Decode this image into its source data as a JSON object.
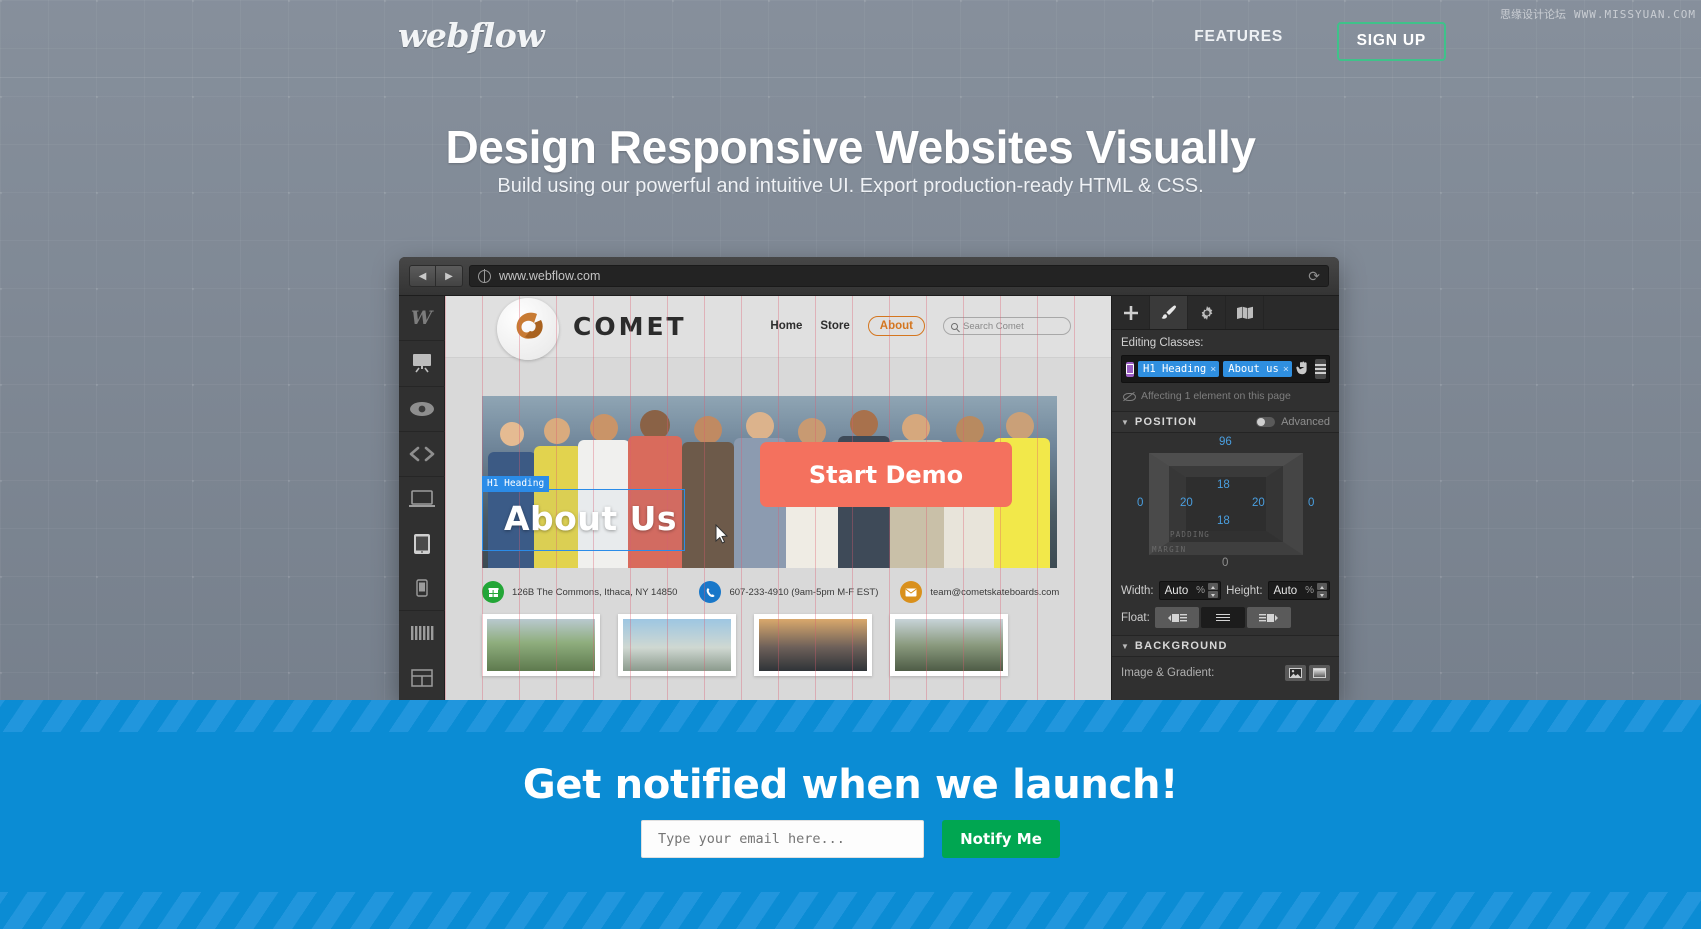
{
  "site": {
    "logo_text": "webflow",
    "nav": {
      "features": "FEATURES",
      "signup": "SIGN UP"
    },
    "watermark_cn": "思缘设计论坛",
    "watermark_url": "WWW.MISSYUAN.COM"
  },
  "hero": {
    "title": "Design Responsive Websites Visually",
    "subtitle": "Build using our powerful and intuitive UI. Export production-ready HTML & CSS."
  },
  "browser": {
    "back_icon": "◀",
    "forward_icon": "▶",
    "url": "www.webflow.com",
    "reload_icon": "⟳"
  },
  "designer": {
    "left_toolbar": [
      {
        "name": "webflow-logo",
        "glyph": "W"
      },
      {
        "name": "add-panel",
        "glyph": "▭"
      },
      {
        "name": "preview-eye",
        "glyph": "◉"
      },
      {
        "name": "code-view",
        "glyph": "<>"
      },
      {
        "name": "desktop-view",
        "glyph": "▭"
      },
      {
        "name": "tablet-view",
        "glyph": "▯"
      },
      {
        "name": "mobile-view",
        "glyph": "▯"
      },
      {
        "name": "columns-view",
        "glyph": "||||"
      },
      {
        "name": "layout-view",
        "glyph": "▤"
      }
    ],
    "canvas_site": {
      "brand": "COMET",
      "links": [
        {
          "label": "Home",
          "active": false
        },
        {
          "label": "Store",
          "active": false
        },
        {
          "label": "About",
          "active": true
        }
      ],
      "search_placeholder": "Search Comet",
      "selection_tag": "H1  Heading",
      "heading": "About Us",
      "cta_button": "Start Demo",
      "contacts": [
        {
          "icon": "store-icon",
          "color": "#23a637",
          "text": "126B The Commons, Ithaca, NY 14850"
        },
        {
          "icon": "phone-icon",
          "color": "#1877c9",
          "text": "607-233-4910 (9am-5pm M-F EST)"
        },
        {
          "icon": "mail-icon",
          "color": "#d9901c",
          "text": "team@cometskateboards.com"
        }
      ]
    },
    "right_panel": {
      "tabs": [
        {
          "name": "add-elements-tab",
          "glyph": "✛",
          "active": false
        },
        {
          "name": "style-brush-tab",
          "glyph": "🖌",
          "active": true
        },
        {
          "name": "settings-gear-tab",
          "glyph": "⚙",
          "active": false
        },
        {
          "name": "site-map-tab",
          "glyph": "📖",
          "active": false
        }
      ],
      "editing_classes_label": "Editing Classes:",
      "classes": [
        {
          "name": "H1 Heading"
        },
        {
          "name": "About us"
        }
      ],
      "class_remove_glyph": "×",
      "affecting_text": "Affecting 1 element on this page",
      "position_section": {
        "title": "POSITION",
        "advanced_label": "Advanced",
        "margin_top": "96",
        "margin_right": "0",
        "margin_bottom": "0",
        "margin_left": "0",
        "padding_top": "18",
        "padding_right": "20",
        "padding_bottom": "18",
        "padding_left": "20",
        "padding_label": "PADDING",
        "margin_label": "MARGIN"
      },
      "width_label": "Width:",
      "width_value": "Auto",
      "width_unit": "%",
      "height_label": "Height:",
      "height_value": "Auto",
      "height_unit": "%",
      "float_label": "Float:",
      "background_section": {
        "title": "BACKGROUND",
        "row_label": "Image & Gradient:"
      }
    }
  },
  "newsletter": {
    "title": "Get notified when we launch!",
    "email_placeholder": "Type your email here...",
    "button": "Notify Me"
  },
  "colors": {
    "hero_bg": "#7d8794",
    "signup_border": "#3fc28a",
    "blue_section": "#0b8cd4",
    "notify_green": "#00a651",
    "cta_coral": "#f4715e",
    "class_chip": "#2f8fe0",
    "value_blue": "#4a9fe0"
  }
}
